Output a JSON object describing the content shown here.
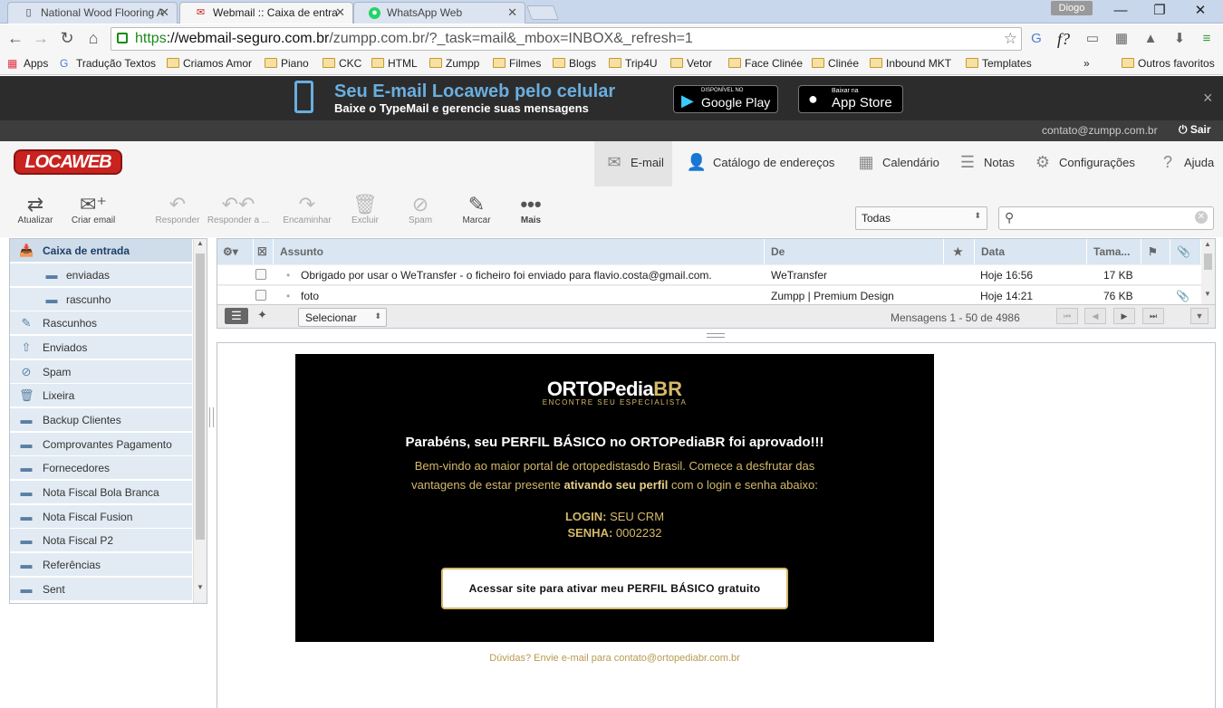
{
  "browser": {
    "tabs": [
      {
        "title": "National Wood Flooring A"
      },
      {
        "title": "Webmail :: Caixa de entra"
      },
      {
        "title": "WhatsApp Web"
      }
    ],
    "profile": "Diogo",
    "url_scheme": "https",
    "url_host": "://webmail-seguro.com.br",
    "url_path": "/zumpp.com.br/?_task=mail&_mbox=INBOX&_refresh=1",
    "bookmarks": [
      "Apps",
      "Tradução Textos",
      "Criamos Amor",
      "Piano",
      "CKC",
      "HTML",
      "Zumpp",
      "Filmes",
      "Blogs",
      "Trip4U",
      "Vetor",
      "Face Clinée",
      "Clinée",
      "Inbound MKT",
      "Templates"
    ],
    "bookmarks_overflow": "»",
    "other_bookmarks": "Outros favoritos"
  },
  "banner": {
    "title": "Seu E-mail Locaweb pelo celular",
    "subtitle": "Baixe o TypeMail e gerencie suas mensagens",
    "google_play_small": "DISPONÍVEL NO",
    "google_play": "Google Play",
    "app_store_small": "Baixar na",
    "app_store": "App Store",
    "close": "×"
  },
  "userbar": {
    "email": "contato@zumpp.com.br",
    "logout": "Sair"
  },
  "app": {
    "logo": "LOCAWEB",
    "nav": [
      "E-mail",
      "Catálogo de endereços",
      "Calendário",
      "Notas",
      "Configurações",
      "Ajuda"
    ],
    "toolbar": [
      "Atualizar",
      "Criar email",
      "Responder",
      "Responder a ...",
      "Encaminhar",
      "Excluir",
      "Spam",
      "Marcar",
      "Mais"
    ],
    "filter": "Todas",
    "search_placeholder": ""
  },
  "folders": [
    {
      "name": "Caixa de entrada"
    },
    {
      "name": "enviadas"
    },
    {
      "name": "rascunho"
    },
    {
      "name": "Rascunhos"
    },
    {
      "name": "Enviados"
    },
    {
      "name": "Spam"
    },
    {
      "name": "Lixeira"
    },
    {
      "name": "Backup Clientes"
    },
    {
      "name": "Comprovantes Pagamento"
    },
    {
      "name": "Fornecedores"
    },
    {
      "name": "Nota Fiscal Bola Branca"
    },
    {
      "name": "Nota Fiscal Fusion"
    },
    {
      "name": "Nota Fiscal P2"
    },
    {
      "name": "Referências"
    },
    {
      "name": "Sent"
    }
  ],
  "list": {
    "headers": {
      "subject": "Assunto",
      "from": "De",
      "star": "★",
      "date": "Data",
      "size": "Tama...",
      "flag": "⚑",
      "attach": "📎"
    },
    "rows": [
      {
        "subject": "Obrigado por usar o WeTransfer - o ficheiro foi enviado para flavio.costa@gmail.com.",
        "from": "WeTransfer",
        "date": "Hoje 16:56",
        "size": "17 KB"
      },
      {
        "subject": "foto",
        "from": "Zumpp | Premium Design",
        "date": "Hoje 14:21",
        "size": "76 KB"
      }
    ],
    "select_label": "Selecionar",
    "count_text": "Mensagens 1 - 50 de 4986"
  },
  "email": {
    "brand_a": "ORTOPedia",
    "brand_b": "BR",
    "brand_tag": "ENCONTRE SEU ESPECIALISTA",
    "headline": "Parabéns, seu PERFIL BÁSICO no ORTOPediaBR foi aprovado!!!",
    "body1": "Bem-vindo ao maior portal de ortopedistasdo Brasil. Comece a desfrutar das",
    "body2_pre": "vantagens de estar presente ",
    "body2_bold": "ativando seu perfil",
    "body2_post": " com o login e senha abaixo:",
    "login_label": "LOGIN:",
    "login_value": "SEU CRM",
    "pass_label": "SENHA:",
    "pass_value": "0002232",
    "cta": "Acessar site para ativar meu PERFIL BÁSICO gratuito",
    "footer": "Dúvidas? Envie e-mail para contato@ortopediabr.com.br"
  },
  "colors": {
    "accent": "#d4b96a",
    "locaweb_red": "#c8231f",
    "banner_blue": "#6aaedf"
  }
}
